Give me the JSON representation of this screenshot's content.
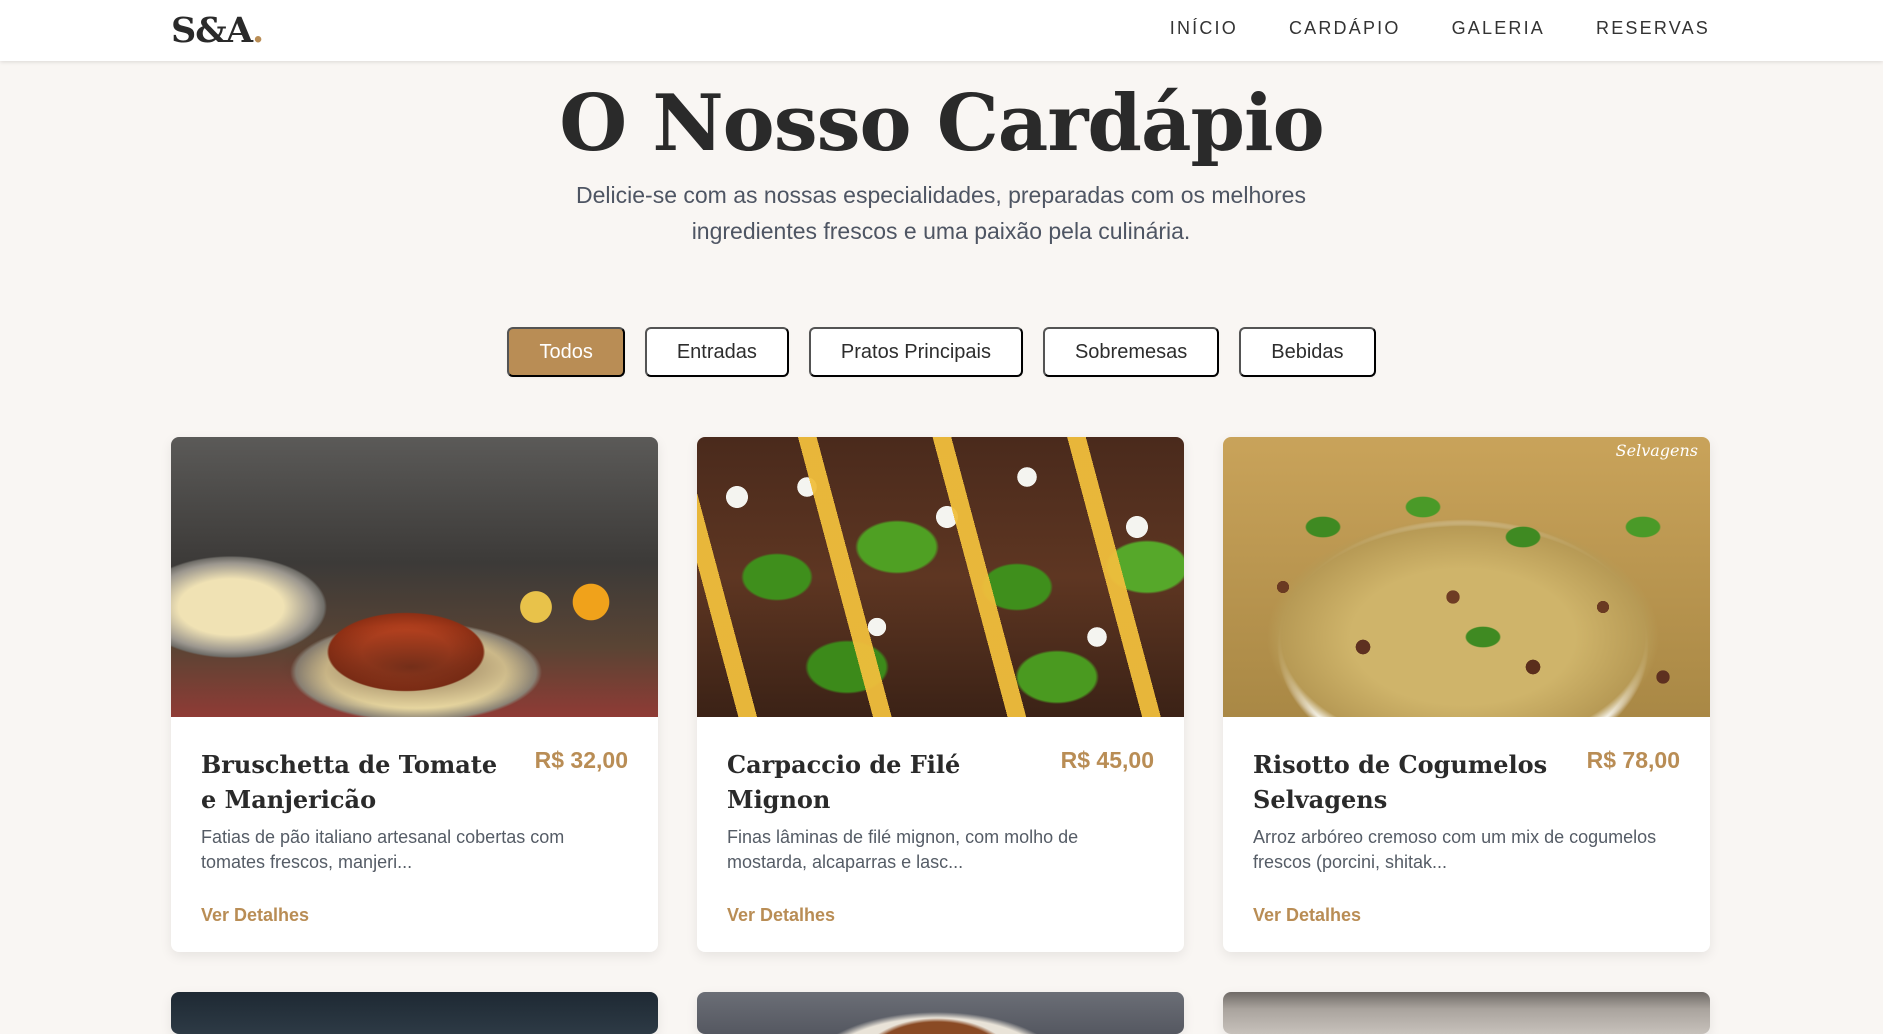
{
  "header": {
    "logo": "S&A",
    "logo_dot": ".",
    "nav": [
      "INÍCIO",
      "CARDÁPIO",
      "GALERIA",
      "RESERVAS"
    ]
  },
  "hero": {
    "title": "O Nosso Cardápio",
    "subtitle": "Delicie-se com as nossas especialidades, preparadas com os melhores ingredientes frescos e uma paixão pela culinária."
  },
  "filters": {
    "items": [
      "Todos",
      "Entradas",
      "Pratos Principais",
      "Sobremesas",
      "Bebidas"
    ],
    "active": "Todos"
  },
  "cards": [
    {
      "name": "Bruschetta de Tomate e Manjericão",
      "price": "R$ 32,00",
      "description": "Fatias de pão italiano artesanal cobertas com tomates frescos, manjeri...",
      "link": "Ver Detalhes"
    },
    {
      "name": "Carpaccio de Filé Mignon",
      "price": "R$ 45,00",
      "description": "Finas lâminas de filé mignon, com molho de mostarda, alcaparras e lasc...",
      "link": "Ver Detalhes"
    },
    {
      "name": "Risotto de Cogumelos Selvagens",
      "price": "R$ 78,00",
      "description": "Arroz arbóreo cremoso com um mix de cogumelos frescos (porcini, shitak...",
      "link": "Ver Detalhes",
      "image_caption": "Selvagens"
    }
  ],
  "colors": {
    "accent": "#b98d55",
    "background": "#f9f6f3",
    "heading": "#2a2a2a"
  }
}
